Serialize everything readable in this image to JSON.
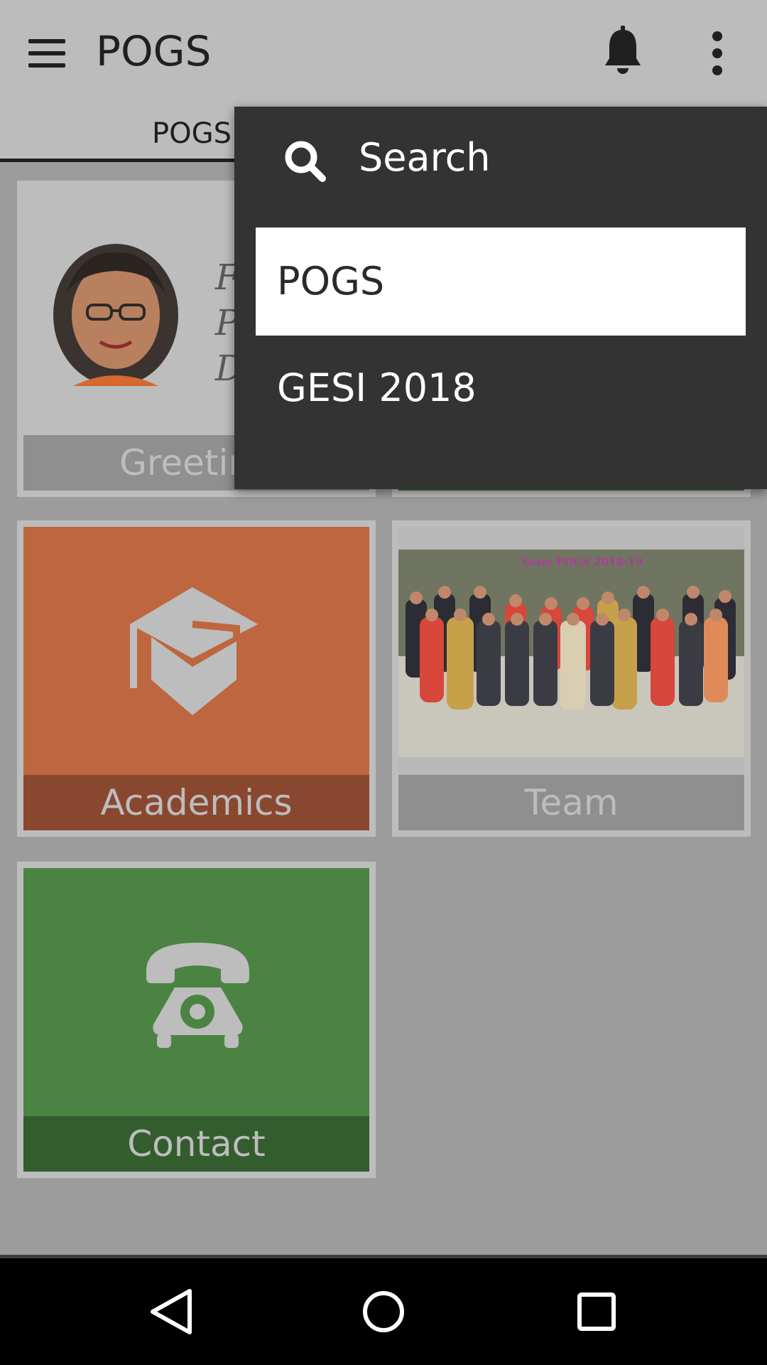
{
  "appbar": {
    "title": "POGS",
    "menu_icon": "hamburger-icon",
    "notification_icon": "bell-icon",
    "overflow_icon": "more-vertical-icon"
  },
  "tabs": [
    {
      "label": "POGS",
      "selected": true
    }
  ],
  "tiles": {
    "greetings": {
      "label": "Greeting",
      "quote_lines": [
        "Fr",
        "Pr",
        "D"
      ]
    },
    "academics": {
      "label": "Academics",
      "icon": "graduation-cap-icon"
    },
    "team": {
      "label": "Team",
      "photo_caption": "Team POGS 2018-19"
    },
    "contact": {
      "label": "Contact",
      "icon": "telephone-icon"
    }
  },
  "menu": {
    "search_label": "Search",
    "search_icon": "search-icon",
    "items": [
      {
        "label": "POGS",
        "selected": true
      },
      {
        "label": "GESI 2018",
        "selected": false
      }
    ]
  },
  "navbar": {
    "back_icon": "back-triangle-icon",
    "home_icon": "home-circle-icon",
    "recents_icon": "recents-square-icon"
  },
  "colors": {
    "appbar": "#bcbcbc",
    "scrim_background": "#9c9c9c",
    "menu": "#333333",
    "academics": "#bd6640",
    "contact": "#4b8343"
  }
}
